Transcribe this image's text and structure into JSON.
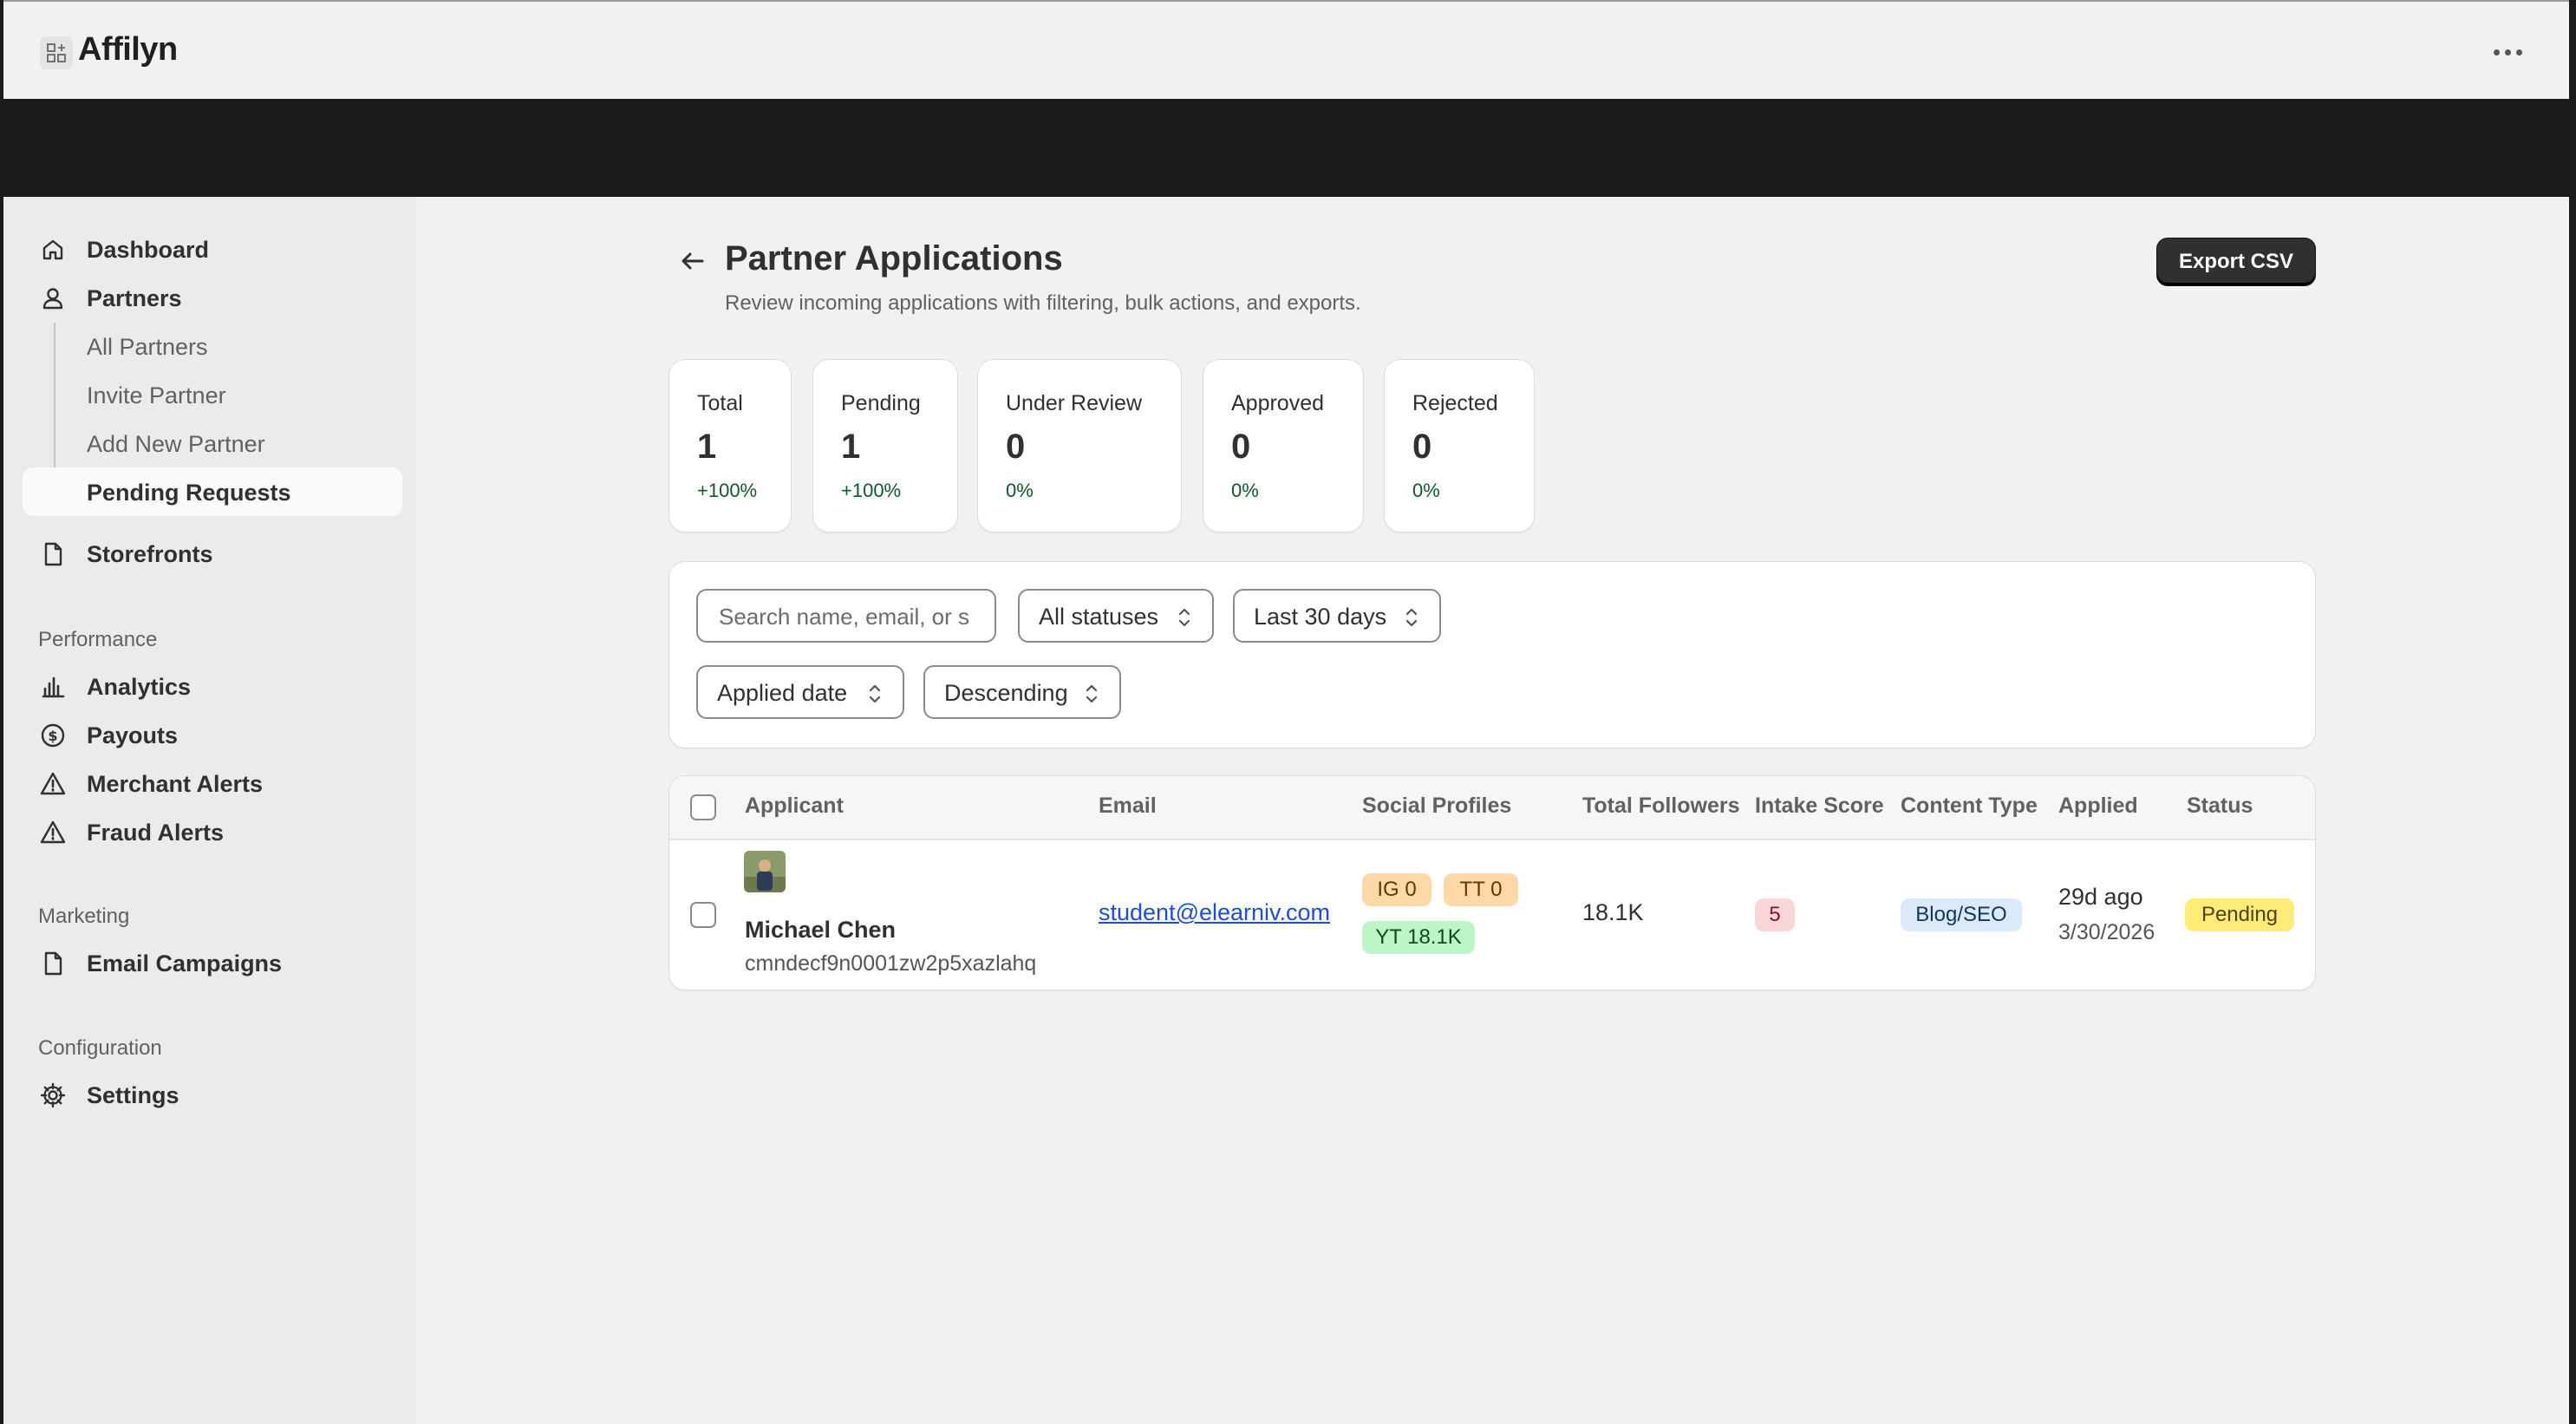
{
  "app": {
    "name": "Affilyn"
  },
  "nav": {
    "dashboard": "Dashboard",
    "partners": "Partners",
    "all_partners": "All Partners",
    "invite_partner": "Invite Partner",
    "add_new_partner": "Add New Partner",
    "pending_requests": "Pending Requests",
    "storefronts": "Storefronts",
    "performance_label": "Performance",
    "analytics": "Analytics",
    "payouts": "Payouts",
    "merchant_alerts": "Merchant Alerts",
    "fraud_alerts": "Fraud Alerts",
    "marketing_label": "Marketing",
    "email_campaigns": "Email Campaigns",
    "configuration_label": "Configuration",
    "settings": "Settings"
  },
  "page": {
    "title": "Partner Applications",
    "subtitle": "Review incoming applications with filtering, bulk actions, and exports.",
    "export_label": "Export CSV"
  },
  "stats": [
    {
      "label": "Total",
      "value": "1",
      "change": "+100%"
    },
    {
      "label": "Pending",
      "value": "1",
      "change": "+100%"
    },
    {
      "label": "Under Review",
      "value": "0",
      "change": "0%"
    },
    {
      "label": "Approved",
      "value": "0",
      "change": "0%"
    },
    {
      "label": "Rejected",
      "value": "0",
      "change": "0%"
    }
  ],
  "filters": {
    "search_placeholder": "Search name, email, or s",
    "status": "All statuses",
    "range": "Last 30 days",
    "sort_by": "Applied date",
    "order": "Descending"
  },
  "table": {
    "headers": {
      "applicant": "Applicant",
      "email": "Email",
      "social": "Social Profiles",
      "followers": "Total Followers",
      "score": "Intake Score",
      "content_type": "Content Type",
      "applied": "Applied",
      "status": "Status"
    },
    "rows": [
      {
        "name": "Michael Chen",
        "id": "cmndecf9n0001zw2p5xazlahq",
        "email": "student@elearniv.com",
        "social_ig": "IG 0",
        "social_tt": "TT 0",
        "social_yt": "YT 18.1K",
        "followers": "18.1K",
        "score": "5",
        "content_type": "Blog/SEO",
        "applied_relative": "29d ago",
        "applied_date": "3/30/2026",
        "status": "Pending"
      }
    ]
  },
  "colors": {
    "badge_orange": "#fed8a6",
    "badge_green": "#bdf5c6",
    "badge_red": "#fbd6d8",
    "badge_blue": "#dbe9fb",
    "badge_yellow": "#ffeb78",
    "positive_text": "#0b5a2a"
  }
}
